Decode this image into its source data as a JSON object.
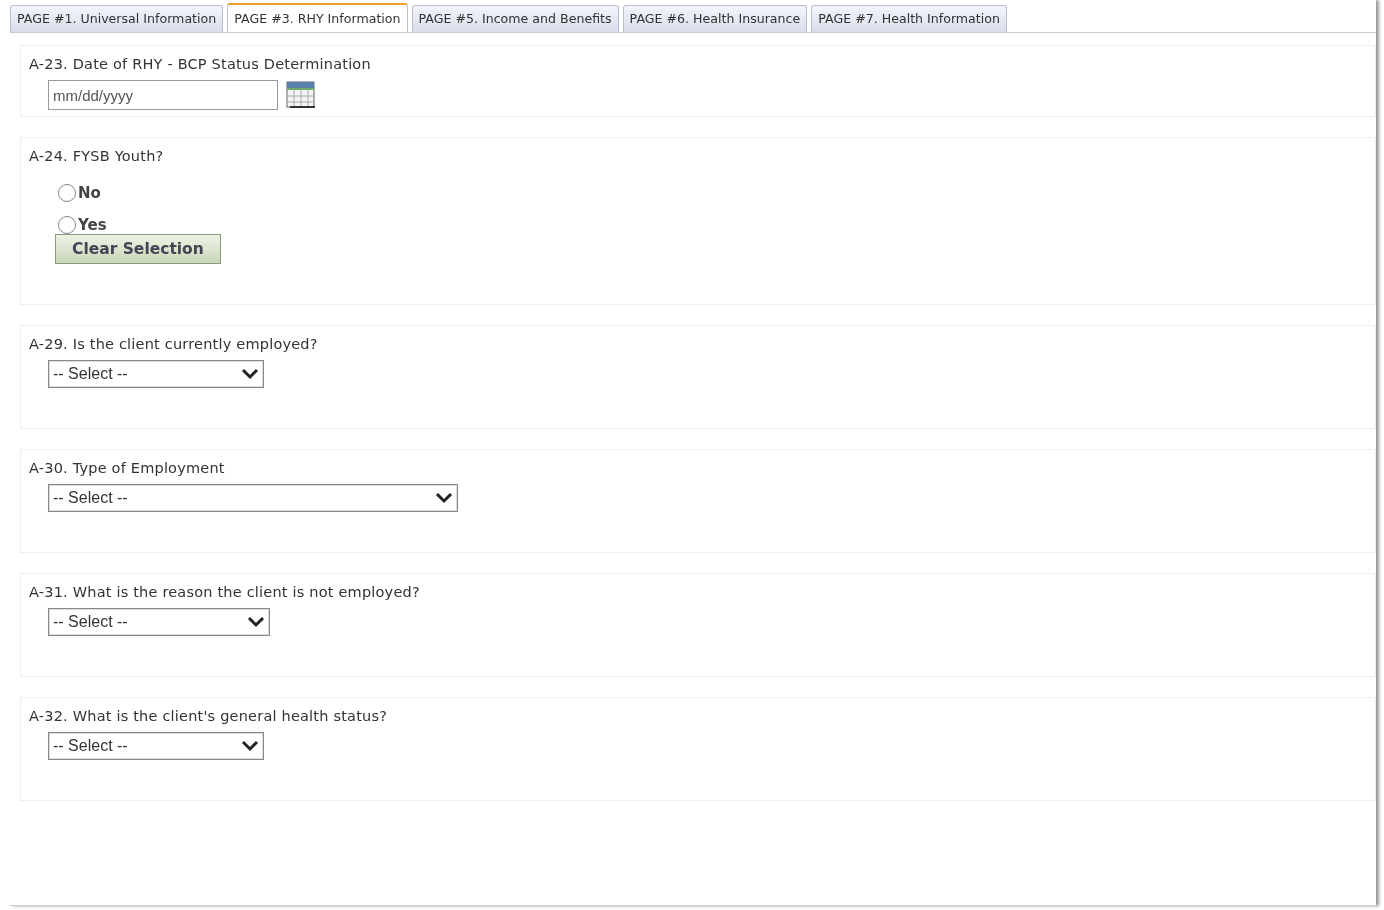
{
  "tabs": [
    {
      "label": "PAGE #1. Universal Information",
      "selected": false
    },
    {
      "label": "PAGE #3. RHY Information",
      "selected": true
    },
    {
      "label": "PAGE #5. Income and Benefits",
      "selected": false
    },
    {
      "label": "PAGE #6. Health Insurance",
      "selected": false
    },
    {
      "label": "PAGE #7. Health Information",
      "selected": false
    }
  ],
  "questions": [
    {
      "kind": "date",
      "label": "A-23. Date of RHY - BCP Status Determination",
      "placeholder": "mm/dd/yyyy"
    },
    {
      "kind": "radio",
      "label": "A-24. FYSB Youth?",
      "options": [
        {
          "label": "No",
          "selected": false
        },
        {
          "label": "Yes",
          "selected": false
        }
      ],
      "button": "Clear Selection"
    },
    {
      "kind": "select",
      "label": "A-29. Is the client currently employed?",
      "value": "-- Select --"
    },
    {
      "kind": "select",
      "label": "A-30. Type of Employment",
      "value": "-- Select --"
    },
    {
      "kind": "select",
      "label": "A-31. What is the reason the client is not employed?",
      "value": "-- Select --"
    },
    {
      "kind": "select",
      "label": "A-32. What is the client's general health status?",
      "value": "-- Select --"
    }
  ]
}
